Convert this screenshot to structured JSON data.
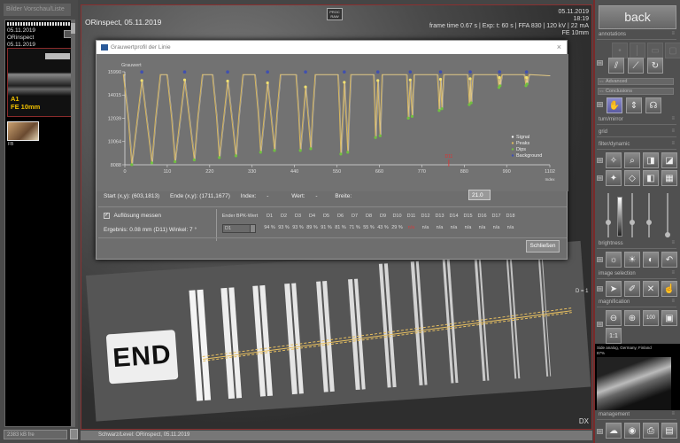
{
  "left_panel": {
    "header": "Bilder Vorschau/Liste",
    "thumb_meta": [
      "05.11.2019",
      "ORinspect",
      "05.11.2019"
    ],
    "thumb1_label": [
      "A1",
      "FE 10mm"
    ],
    "thumb2_label": "FB",
    "footer_value": "2383 kB fre"
  },
  "viewer": {
    "title": "ORinspect, 05.11.2019",
    "proc_badge": [
      "PROC",
      "RAW"
    ],
    "info_lines": [
      "05.11.2019",
      "18:19",
      "frame time 0.67 s | Exp: t: 60 s | FFA 830 | 120 kV | 22 mA",
      "FE 10mm"
    ],
    "marker_label": "D = 1",
    "orientation_label": "DX",
    "end_tag": "END"
  },
  "status_bar": {
    "text": "Schwarz/Level: ORinspect, 05.11.2019"
  },
  "dialog": {
    "title": "Grauwertprofil der Linie",
    "close_icon": "×",
    "info": {
      "start": "Start (x,y): (603,1813)",
      "end": "Ende (x,y): (1711,1677)",
      "index_label": "Index:",
      "index_value": "-",
      "wert_label": "Wert:",
      "wert_value": "-",
      "breite_label": "Breite:",
      "breite_value": "21.0"
    },
    "checkbox_label": "Auflösung messen",
    "checkbox_checked": true,
    "ergebnis": "Ergebnis: 0.08 mm (D11) Winkel: 7 °",
    "table": {
      "spin_header": "Ender BPK-Wert",
      "spin_value": "D1",
      "columns": [
        "D1",
        "D2",
        "D3",
        "D4",
        "D5",
        "D6",
        "D7",
        "D8",
        "D9",
        "D10",
        "D11",
        "D12",
        "D13",
        "D14",
        "D15",
        "D16",
        "D17",
        "D18"
      ],
      "values": [
        "94 %",
        "93 %",
        "93 %",
        "89 %",
        "91 %",
        "81 %",
        "71 %",
        "55 %",
        "43 %",
        "29 %",
        "n/a",
        "n/a",
        "n/a",
        "n/a",
        "n/a",
        "n/a",
        "n/a",
        "n/a"
      ],
      "highlight_index": 10
    },
    "close_button": "Schließen"
  },
  "chart_data": {
    "type": "line",
    "title": "",
    "ylabel": "Grauwert",
    "xlabel": "Index",
    "y_ticks": [
      8088,
      10064,
      12039,
      14015,
      15990
    ],
    "x_ticks": [
      0,
      110,
      220,
      330,
      440,
      550,
      660,
      770,
      880,
      990,
      1102
    ],
    "ylim": [
      8088,
      15990
    ],
    "xlim": [
      0,
      1102
    ],
    "legend": [
      "Signal",
      "Peaks",
      "Dips",
      "Background"
    ],
    "legend_position": "bottom-right",
    "cursor_marker_x": 840,
    "cursor_marker_label": "D11",
    "dip_pairs": [
      {
        "x": [
          18,
          70
        ],
        "dip": 8100,
        "peak": 15250
      },
      {
        "x": [
          130,
          180
        ],
        "dip": 8350,
        "peak": 15300
      },
      {
        "x": [
          245,
          288
        ],
        "dip": 8700,
        "peak": 15200
      },
      {
        "x": [
          352,
          388
        ],
        "dip": 9150,
        "peak": 15050
      },
      {
        "x": [
          455,
          482
        ],
        "dip": 9300,
        "peak": 14700
      },
      {
        "x": [
          560,
          578
        ],
        "dip": 9000,
        "peak": 15100
      },
      {
        "x": [
          650,
          662
        ],
        "dip": 10400,
        "peak": 15250
      },
      {
        "x": [
          735,
          745
        ],
        "dip": 12050,
        "peak": 15300
      },
      {
        "x": [
          815,
          822
        ],
        "dip": 12700,
        "peak": 15350
      },
      {
        "x": [
          893,
          898
        ],
        "dip": 13200,
        "peak": 15400
      },
      {
        "x": [
          970,
          973
        ],
        "dip": 14650,
        "peak": 15500
      },
      {
        "x": [
          1040,
          1043
        ],
        "dip": 14800,
        "peak": 15500
      }
    ],
    "baseline": 15750
  },
  "right_panel": {
    "back_label": "back",
    "sections": {
      "annotations": "annotations",
      "advanced": "Advanced",
      "conclusions": "Conclusions",
      "turn_mirror": "turn/mirror",
      "grid": "grid",
      "filter_dynamic": "filter/dynamic",
      "brightness": "brightness",
      "image_selection": "image selection",
      "magnification": "magnification",
      "management": "management"
    },
    "magnify_1to1": "1:1",
    "preview_text": [
      "Side analog, Germany, Finland",
      "87%"
    ]
  }
}
